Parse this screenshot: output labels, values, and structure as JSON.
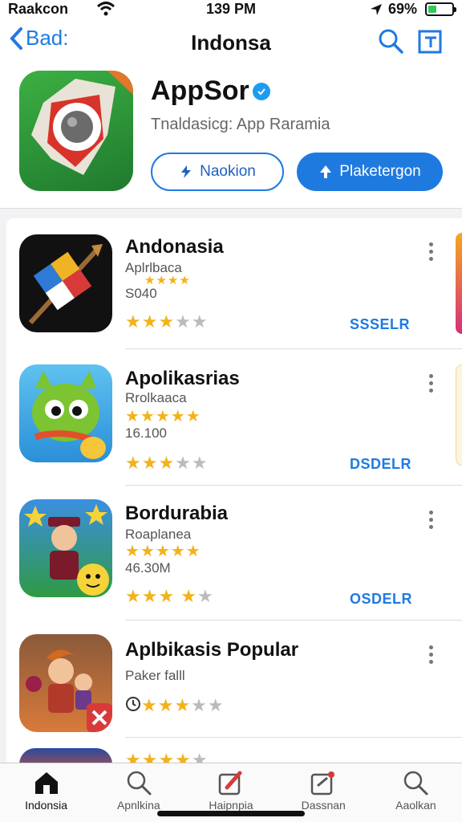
{
  "status_bar": {
    "carrier": "Raakcon",
    "time": "139 PM",
    "battery": "69%"
  },
  "nav": {
    "back_label": "Bad:",
    "title": "Indonsa"
  },
  "hero": {
    "app_name": "AppSor",
    "subtitle": "Tnaldasicg: App Raramia",
    "outline_button": "Naokion",
    "solid_button": "Plaketergon"
  },
  "apps": [
    {
      "name": "Andonasia",
      "sub": "Aplrlbaca",
      "size": "S040",
      "rating": 3.5,
      "small_rating": "★★★★",
      "action": "SSSELR"
    },
    {
      "name": "Apolikasrias",
      "sub": "Rrolkaaca",
      "size": "16.100",
      "rating": 3.5,
      "small_rating": "★★★★★",
      "action": "DSDELR"
    },
    {
      "name": "Bordurabia",
      "sub": "Roaplanea",
      "size": "46.30M",
      "rating": 3.5,
      "small_rating": "★★★★★",
      "action": "OSDELR"
    },
    {
      "name": "Aplbikasis Popular",
      "sub": "Paker falll",
      "size": "",
      "rating": 3.5,
      "small_rating": "",
      "action": ""
    }
  ],
  "tabs": [
    {
      "label": "Indonsia",
      "icon": "home-icon",
      "active": true
    },
    {
      "label": "Apnlkina",
      "icon": "search-icon",
      "active": false
    },
    {
      "label": "Haipnpia",
      "icon": "pencil-icon",
      "active": false
    },
    {
      "label": "Dassnan",
      "icon": "notes-icon",
      "active": false
    },
    {
      "label": "Aaolkan",
      "icon": "search-icon",
      "active": false
    }
  ],
  "colors": {
    "accent": "#1f7ae0",
    "star": "#f3b21b",
    "battery": "#35c759"
  }
}
